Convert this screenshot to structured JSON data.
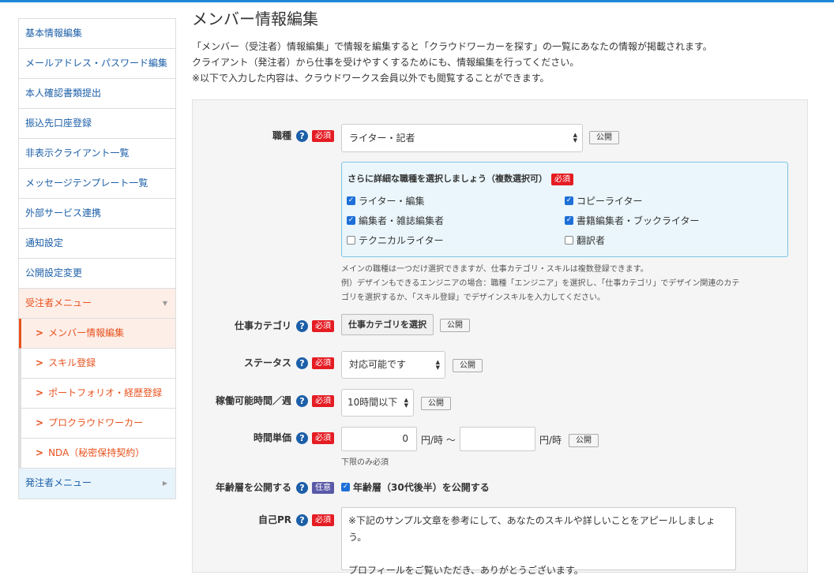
{
  "sidebar": {
    "items": [
      {
        "label": "基本情報編集"
      },
      {
        "label": "メールアドレス・パスワード編集"
      },
      {
        "label": "本人確認書類提出"
      },
      {
        "label": "振込先口座登録"
      },
      {
        "label": "非表示クライアント一覧"
      },
      {
        "label": "メッセージテンプレート一覧"
      },
      {
        "label": "外部サービス連携"
      },
      {
        "label": "通知設定"
      },
      {
        "label": "公開設定変更"
      }
    ],
    "contractor_menu": "受注者メニュー",
    "sub_items": [
      {
        "label": "メンバー情報編集",
        "active": true
      },
      {
        "label": "スキル登録"
      },
      {
        "label": "ポートフォリオ・経歴登録"
      },
      {
        "label": "プロクラウドワーカー"
      },
      {
        "label": "NDA（秘密保持契約）"
      }
    ],
    "client_menu": "発注者メニュー"
  },
  "page": {
    "title": "メンバー情報編集",
    "intro": [
      "「メンバー（受注者）情報編集」で情報を編集すると「クラウドワーカーを探す」の一覧にあなたの情報が掲載されます。",
      "クライアント（発注者）から仕事を受けやすくするためにも、情報編集を行ってください。",
      "※以下で入力した内容は、クラウドワークス会員以外でも閲覧することができます。"
    ]
  },
  "badges": {
    "required": "必須",
    "optional": "任意",
    "public": "公開",
    "help": "?"
  },
  "form": {
    "job": {
      "label": "職種",
      "value": "ライター・記者",
      "detail_header": "さらに詳細な職種を選択しましょう（複数選択可）",
      "options": [
        {
          "label": "ライター・編集",
          "checked": true
        },
        {
          "label": "コピーライター",
          "checked": true
        },
        {
          "label": "編集者・雑誌編集者",
          "checked": true
        },
        {
          "label": "書籍編集者・ブックライター",
          "checked": true
        },
        {
          "label": "テクニカルライター",
          "checked": false
        },
        {
          "label": "翻訳者",
          "checked": false
        }
      ],
      "note": [
        "メインの職種は一つだけ選択できますが、仕事カテゴリ・スキルは複数登録できます。",
        "例）デザインもできるエンジニアの場合：職種「エンジニア」を選択し、「仕事カテゴリ」でデザイン関連のカテ",
        "ゴリを選択するか、「スキル登録」でデザインスキルを入力してください。"
      ]
    },
    "category": {
      "label": "仕事カテゴリ",
      "button": "仕事カテゴリを選択"
    },
    "status": {
      "label": "ステータス",
      "value": "対応可能です"
    },
    "hours": {
      "label": "稼働可能時間／週",
      "value": "10時間以下"
    },
    "rate": {
      "label": "時間単価",
      "min": "0",
      "max": "",
      "unit": "円/時",
      "tilde": "〜",
      "note": "下限のみ必須"
    },
    "age": {
      "label": "年齢層を公開する",
      "checkbox": "年齢層（30代後半）を公開する",
      "checked": true
    },
    "pr": {
      "label": "自己PR",
      "lines": [
        "※下記のサンプル文章を参考にして、あなたのスキルや詳しいことをアピールしましょ",
        "う。",
        "",
        "プロフィールをご覧いただき、ありがとうございます。"
      ]
    }
  }
}
